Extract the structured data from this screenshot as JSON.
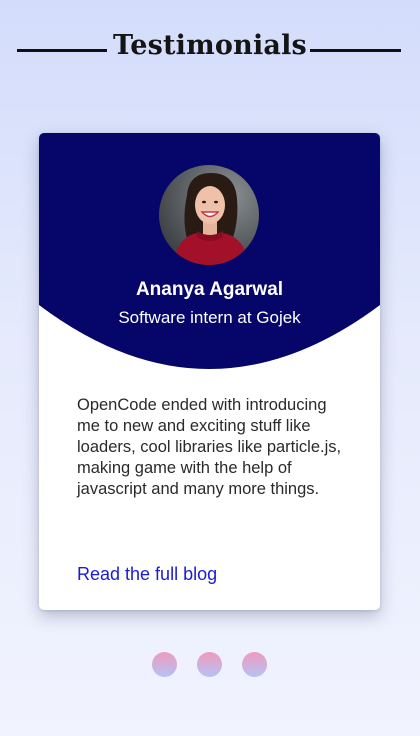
{
  "header": {
    "title": "Testimonials"
  },
  "testimonial": {
    "name": "Ananya Agarwal",
    "role": "Software intern at Gojek",
    "quote": "OpenCode ended with introducing me to new and exciting stuff like loaders, cool libraries like particle.js, making game with the help of javascript and many more things.",
    "link_label": "Read the full blog"
  },
  "carousel": {
    "slide_count": 3
  },
  "colors": {
    "card_header": "#05056a",
    "link": "#1a1adc",
    "dot_top": "#ed9bbd",
    "dot_bottom": "#b6c2f4"
  },
  "icons": {
    "avatar": "portrait-photo"
  }
}
